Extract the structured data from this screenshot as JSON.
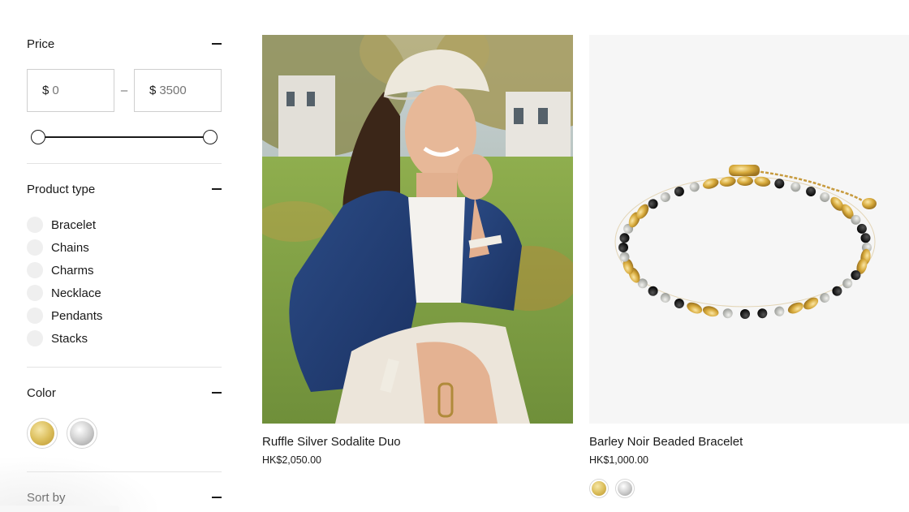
{
  "filters": {
    "price": {
      "title": "Price",
      "currency_symbol": "$",
      "min_value": "0",
      "max_value": "3500"
    },
    "product_type": {
      "title": "Product type",
      "options": [
        "Bracelet",
        "Chains",
        "Charms",
        "Necklace",
        "Pendants",
        "Stacks"
      ]
    },
    "color": {
      "title": "Color",
      "swatches": [
        {
          "name": "gold",
          "hex": "#d8b957"
        },
        {
          "name": "silver",
          "hex": "#c4c4c4"
        }
      ]
    },
    "sort": {
      "title": "Sort by"
    }
  },
  "products": [
    {
      "name": "Ruffle Silver Sodalite Duo",
      "price": "HK$2,050.00",
      "image": "lifestyle-photo-model"
    },
    {
      "name": "Barley Noir Beaded Bracelet",
      "price": "HK$1,000.00",
      "image": "product-photo-bracelet",
      "swatches": [
        "gold",
        "silver"
      ]
    }
  ]
}
